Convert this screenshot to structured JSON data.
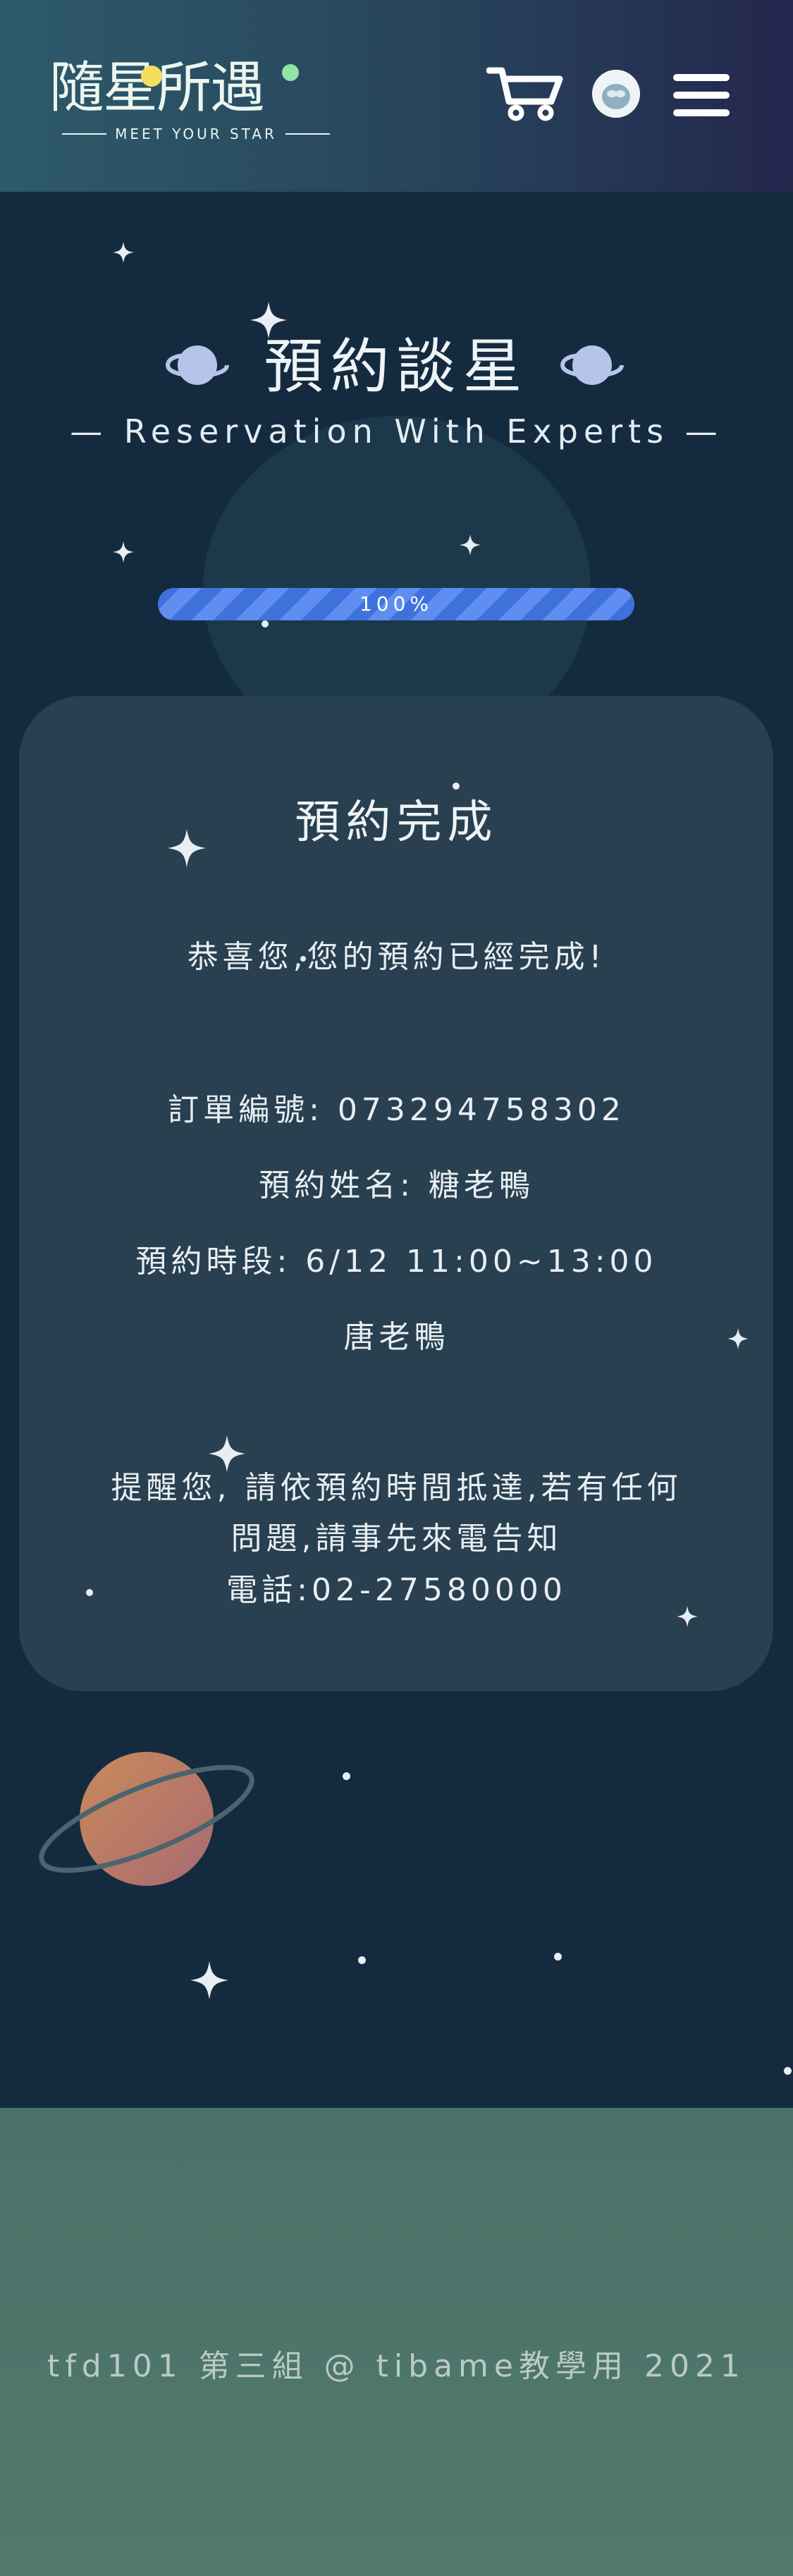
{
  "header": {
    "logo_chars": [
      "隨",
      "星",
      "所",
      "遇"
    ],
    "logo_tagline": "MEET YOUR STAR",
    "cart_icon": "cart-icon",
    "avatar_icon": "avatar-icon",
    "menu_icon": "hamburger-menu-icon"
  },
  "hero": {
    "title": "預約談星",
    "subtitle": "— Reservation With Experts —",
    "planet_icon": "planet-icon"
  },
  "progress": {
    "label": "100%",
    "value": 1.0,
    "colors": {
      "stripe_a": "#3e71dc",
      "stripe_b": "#5f8ef0"
    }
  },
  "card": {
    "title": "預約完成",
    "congrats": "恭喜您,您的預約已經完成!",
    "order_number": "訂單編號: 073294758302",
    "name": "預約姓名: 糖老鴨",
    "time_slot": "預約時段: 6/12 11:00~13:00",
    "expert": "唐老鴨",
    "reminder_line1": "提醒您, 請依預約時間抵達,若有任何",
    "reminder_line2": "問題,請事先來電告知",
    "phone": "電話:02-27580000"
  },
  "footer": {
    "text": "tfd101 第三組 @ tibame教學用 2021"
  },
  "colors": {
    "background": "#142b3f",
    "card": "#28404f",
    "footer": "#4a7268",
    "accent": "#3e71dc"
  }
}
